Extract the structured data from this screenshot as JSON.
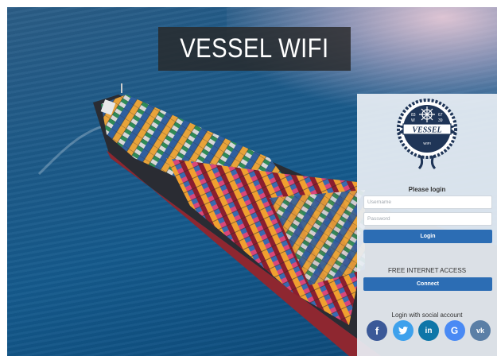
{
  "page": {
    "title": "VESSEL WIFI"
  },
  "logo": {
    "text": "VESSEL",
    "subtext": "WIFI",
    "cells": [
      "83",
      "W",
      "67",
      "39"
    ]
  },
  "login": {
    "heading": "Please login",
    "username_placeholder": "Username",
    "password_placeholder": "Password",
    "login_button": "Login"
  },
  "free_access": {
    "heading": "FREE INTERNET ACCESS",
    "connect_button": "Connect"
  },
  "social": {
    "heading": "Login with social account",
    "buttons": [
      {
        "name": "facebook",
        "glyph": "f",
        "color": "#3b5998"
      },
      {
        "name": "twitter",
        "glyph": "t",
        "color": "#3ea1ec"
      },
      {
        "name": "linkedin",
        "glyph": "in",
        "color": "#0e76a8"
      },
      {
        "name": "google",
        "glyph": "G",
        "color": "#4a8af4"
      },
      {
        "name": "vk",
        "glyph": "vk",
        "color": "#5b7fa6"
      }
    ]
  },
  "colors": {
    "accent": "#2c6db4",
    "logo_navy": "#1f3557"
  }
}
